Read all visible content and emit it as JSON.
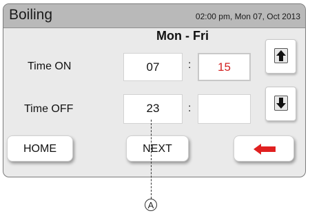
{
  "app": {
    "title": "Boiling",
    "clock": "02:00 pm, Mon 07, Oct 2013"
  },
  "schedule": {
    "day_range": "Mon - Fri",
    "time_on": {
      "label": "Time ON",
      "hour": "07",
      "minute": "15"
    },
    "time_off": {
      "label": "Time OFF",
      "hour": "23",
      "minute": ""
    },
    "separator": ":"
  },
  "buttons": {
    "home": "HOME",
    "next": "NEXT",
    "up_icon": "arrow-up-icon",
    "down_icon": "arrow-down-icon",
    "back_icon": "arrow-left-icon"
  },
  "annotation": {
    "label": "A"
  },
  "colors": {
    "title_bar": "#b9b9b9",
    "panel": "#eaeaea",
    "minute_text": "#d32222",
    "back_arrow": "#e02020"
  }
}
